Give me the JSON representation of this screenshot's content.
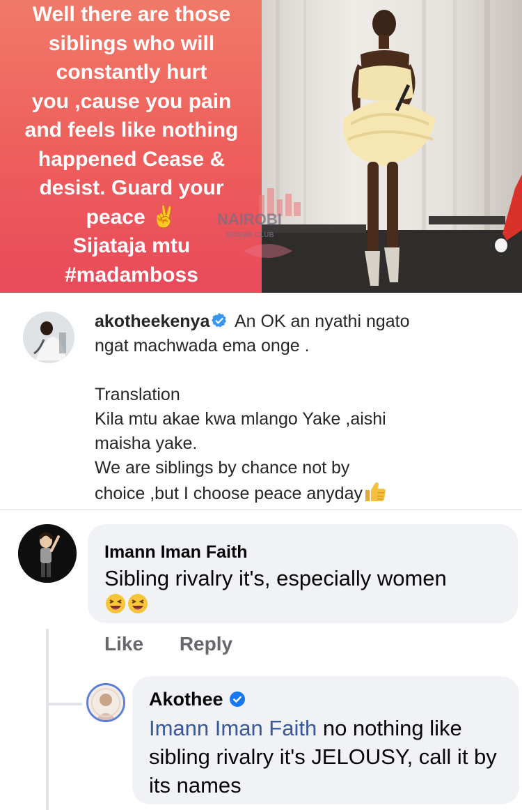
{
  "banner": {
    "quote_lines": [
      "Well there are those",
      "siblings who will",
      "constantly hurt",
      "you ,cause you pain",
      "and feels like  nothing",
      "happened Cease &",
      "desist.  Guard your",
      "peace ✌️",
      "Sijataja mtu",
      "#madamboss"
    ],
    "watermark": "NAIROBI",
    "watermark_sub": "GOSSIP CLUB",
    "colors": {
      "quote_bg": "#ee5d5b",
      "quote_text": "#ffffff"
    }
  },
  "instagram_comment": {
    "username": "akotheekenya",
    "verified_icon": "verified-badge-icon",
    "line1": "An OK an nyathi ngato",
    "line2": "ngat machwada ema onge .",
    "translation_label": "Translation",
    "translation_lines": [
      "Kila mtu akae kwa mlango Yake ,aishi",
      "maisha yake.",
      "We are siblings by chance not by",
      "choice ,but I choose peace anyday"
    ],
    "emoji": "thumbs-up-icon"
  },
  "facebook_thread": {
    "comment": {
      "author": "Imann Iman Faith",
      "text": "Sibling rivalry it's, especially women",
      "emoji": "laughing-face-icon"
    },
    "actions": {
      "like": "Like",
      "reply": "Reply"
    },
    "reply": {
      "author": "Akothee",
      "mention": "Imann Iman Faith",
      "text": " no nothing like sibling rivalry it's JELOUSY, call it by its names"
    },
    "colors": {
      "bubble": "#f0f2f5",
      "mention": "#385898",
      "verified": "#1877f2"
    }
  }
}
